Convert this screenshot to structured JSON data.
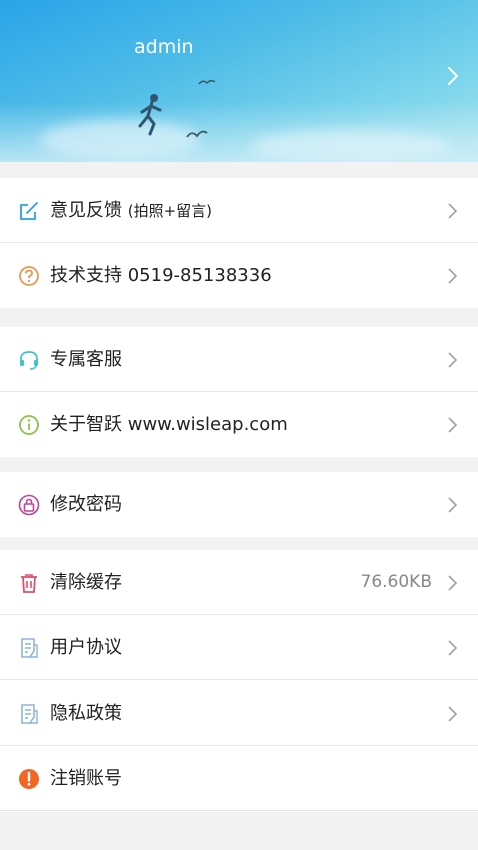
{
  "header": {
    "username": "admin"
  },
  "menu": {
    "feedback": {
      "label": "意见反馈",
      "note": "(拍照+留言)"
    },
    "support": {
      "label": "技术支持 0519-85138336"
    },
    "customer_service": {
      "label": "专属客服"
    },
    "about": {
      "label": "关于智跃 www.wisleap.com"
    },
    "change_password": {
      "label": "修改密码"
    },
    "clear_cache": {
      "label": "清除缓存",
      "value": "76.60KB"
    },
    "user_agreement": {
      "label": "用户协议"
    },
    "privacy_policy": {
      "label": "隐私政策"
    },
    "cancel_account": {
      "label": "注销账号"
    }
  },
  "icons": {
    "feedback": "edit-icon",
    "support": "question-circle-icon",
    "customer_service": "headset-icon",
    "about": "info-circle-icon",
    "change_password": "lock-icon",
    "clear_cache": "trash-icon",
    "user_agreement": "document-icon",
    "privacy_policy": "document-icon",
    "cancel_account": "alert-circle-icon"
  },
  "colors": {
    "header_gradient_start": "#2aa3e8",
    "header_gradient_end": "#a9e4ef",
    "feedback_icon": "#29a3dd",
    "support_icon": "#e59a4e",
    "customer_service_icon": "#3cc7c7",
    "about_icon": "#8bc34a",
    "change_password_icon": "#c2409a",
    "clear_cache_icon": "#e0506a",
    "document_icon": "#8fb4d8",
    "cancel_account_icon": "#f26522"
  }
}
